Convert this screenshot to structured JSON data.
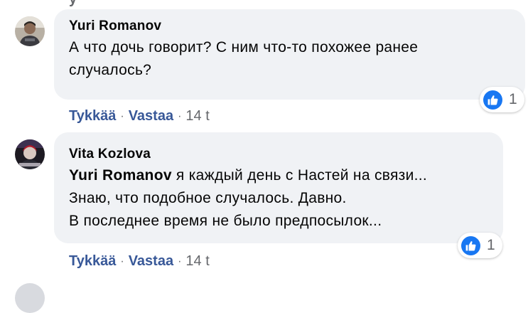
{
  "comments": [
    {
      "author": "Yuri Romanov",
      "mention": "",
      "lines": [
        "А что дочь говорит? С ним что-то похожее ранее",
        "случалось?"
      ],
      "reaction_count": "1",
      "actions": {
        "like": "Tykkää",
        "reply": "Vastaa",
        "time": "14 t"
      },
      "icons": {
        "reaction": "like-icon"
      }
    },
    {
      "author": "Vita Kozlova",
      "mention": "Yuri Romanov",
      "first_line_rest": " я каждый день с Настей на связи...",
      "lines": [
        "Знаю, что подобное случалось. Давно.",
        "В последнее время не было предпосылок..."
      ],
      "reaction_count": "1",
      "actions": {
        "like": "Tykkää",
        "reply": "Vastaa",
        "time": "14 t"
      },
      "icons": {
        "reaction": "like-icon"
      }
    }
  ],
  "separator": "·",
  "colors": {
    "bubble": "#f0f2f5",
    "link": "#385898",
    "like_badge": "#1877f2",
    "meta": "#65676b"
  }
}
